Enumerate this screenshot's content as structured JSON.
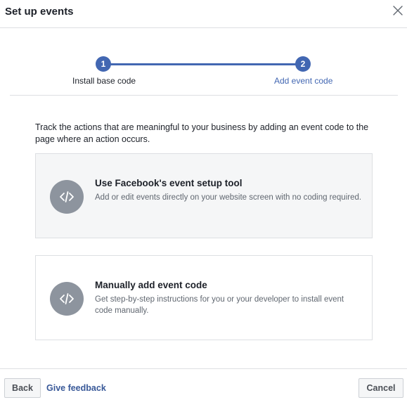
{
  "dialog": {
    "title": "Set up events",
    "close_icon": "close-icon"
  },
  "stepper": {
    "steps": [
      {
        "number": "1",
        "label": "Install base code",
        "state": "completed"
      },
      {
        "number": "2",
        "label": "Add event code",
        "state": "active"
      }
    ],
    "accent_color": "#4267b2"
  },
  "main": {
    "intro": "Track the actions that are meaningful to your business by adding an event code to the page where an action occurs.",
    "options": [
      {
        "title": "Use Facebook's event setup tool",
        "description": "Add or edit events directly on your website screen with no coding required.",
        "icon": "code-icon",
        "highlighted": true
      },
      {
        "title": "Manually add event code",
        "description": "Get step-by-step instructions for you or your developer to install event code manually.",
        "icon": "code-icon",
        "highlighted": false
      }
    ]
  },
  "footer": {
    "back_label": "Back",
    "feedback_label": "Give feedback",
    "cancel_label": "Cancel"
  }
}
